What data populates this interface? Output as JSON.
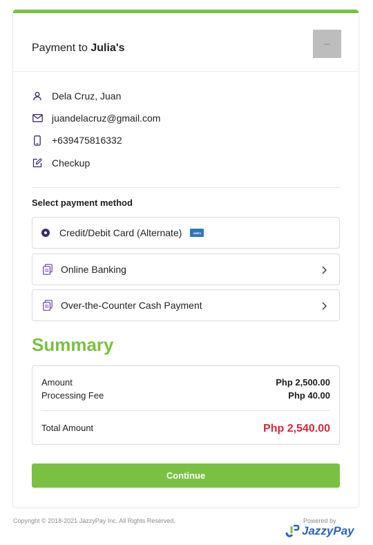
{
  "header": {
    "prefix": "Payment to ",
    "merchant": "Julia's",
    "logo_text": "LOGO"
  },
  "customer": {
    "name": "Dela Cruz, Juan",
    "email": "juandelacruz@gmail.com",
    "phone": "+639475816332",
    "description": "Checkup"
  },
  "payment": {
    "section_title": "Select payment method",
    "methods": [
      {
        "label": "Credit/Debit Card (Alternate)",
        "selected": true,
        "card_icon": "amex-card-icon"
      },
      {
        "label": "Online Banking",
        "selected": false
      },
      {
        "label": "Over-the-Counter Cash Payment",
        "selected": false
      }
    ]
  },
  "summary": {
    "title": "Summary",
    "amount_label": "Amount",
    "amount_value": "Php 2,500.00",
    "fee_label": "Processing Fee",
    "fee_value": "Php 40.00",
    "total_label": "Total Amount",
    "total_value": "Php 2,540.00"
  },
  "continue_label": "Continue",
  "footer": {
    "copyright": "Copyright © 2018-2021 JazzyPay Inc. All Rights Reserved.",
    "powered_by": "Powered by",
    "brand": "JazzyPay"
  },
  "colors": {
    "accent_green": "#7ac143",
    "total_red": "#e0263b",
    "icon_purple": "#3b2a6b",
    "brand_blue": "#2b62b6"
  }
}
